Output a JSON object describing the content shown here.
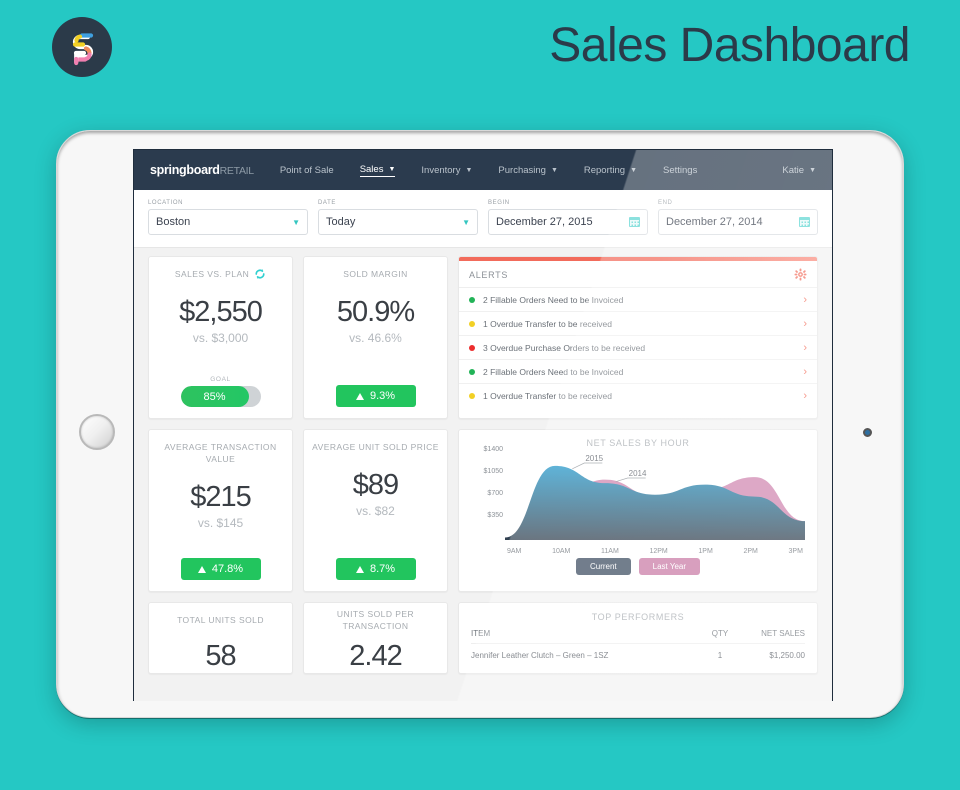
{
  "page": {
    "title": "Sales Dashboard",
    "background_color": "#25C8C4",
    "title_color": "#2B3A49",
    "logo_name": "springboard-logo"
  },
  "navbar": {
    "brand": "springboard",
    "brand_suffix": "RETAIL",
    "items": [
      {
        "label": "Point of Sale",
        "has_caret": false,
        "active": false
      },
      {
        "label": "Sales",
        "has_caret": true,
        "active": true
      },
      {
        "label": "Inventory",
        "has_caret": true,
        "active": false
      },
      {
        "label": "Purchasing",
        "has_caret": true,
        "active": false
      },
      {
        "label": "Reporting",
        "has_caret": true,
        "active": false
      },
      {
        "label": "Settings",
        "has_caret": false,
        "active": false
      }
    ],
    "user": "Katie"
  },
  "filters": [
    {
      "label": "LOCATION",
      "value": "Boston",
      "control": "select"
    },
    {
      "label": "DATE",
      "value": "Today",
      "control": "select"
    },
    {
      "label": "BEGIN",
      "value": "December 27, 2015",
      "control": "date"
    },
    {
      "label": "END",
      "value": "December 27, 2014",
      "control": "date"
    }
  ],
  "kpis": {
    "sales_vs_plan": {
      "title": "SALES VS. PLAN",
      "value": "$2,550",
      "sub": "vs. $3,000",
      "goal_label": "GOAL",
      "goal_value": "85%",
      "goal_percent": 85
    },
    "sold_margin": {
      "title": "SOLD  MARGIN",
      "value": "50.9%",
      "sub": "vs. 46.6%",
      "badge": "9.3%"
    },
    "avg_transaction_value": {
      "title": "AVERAGE TRANSACTION VALUE",
      "value": "$215",
      "sub": "vs. $145",
      "badge": "47.8%"
    },
    "avg_unit_sold_price": {
      "title": "AVERAGE UNIT SOLD PRICE",
      "value": "$89",
      "sub": "vs. $82",
      "badge": "8.7%"
    },
    "total_units_sold": {
      "title": "TOTAL UNITS SOLD",
      "value": "58"
    },
    "units_sold_per_transaction": {
      "title": "UNITS SOLD PER TRANSACTION",
      "value": "2.42"
    }
  },
  "alerts": {
    "title": "ALERTS",
    "accent_color": "#f26b5b",
    "items": [
      {
        "text": "2 Fillable Orders Need to be Invoiced",
        "status_color": "#22b357"
      },
      {
        "text": "1 Overdue Transfer to be received",
        "status_color": "#f2d024"
      },
      {
        "text": "3 Overdue Purchase Orders to be received",
        "status_color": "#ec2d2d"
      },
      {
        "text": "2 Fillable Orders Need to be Invoiced",
        "status_color": "#22b357"
      },
      {
        "text": "1 Overdue Transfer to be received",
        "status_color": "#f2d024"
      }
    ]
  },
  "chart_data": {
    "type": "area",
    "title": "NET SALES BY HOUR",
    "xlabel": "",
    "ylabel": "",
    "ylim": [
      0,
      1400
    ],
    "yticks": [
      "$350",
      "$700",
      "$1050",
      "$1400"
    ],
    "ytick_values": [
      350,
      700,
      1050,
      1400
    ],
    "x": [
      "9AM",
      "10AM",
      "11AM",
      "12PM",
      "1PM",
      "2PM",
      "3PM"
    ],
    "grid": false,
    "legend_position": "bottom",
    "series": [
      {
        "name": "2015",
        "legend": "Current",
        "color": "#3a4a5e",
        "fill_top": "#2196c9",
        "fill_bottom": "#31404f",
        "values": [
          40,
          1180,
          905,
          720,
          880,
          690,
          300
        ]
      },
      {
        "name": "2014",
        "legend": "Last Year",
        "color": "#c878a4",
        "fill": "#cf84ae",
        "values": [
          40,
          640,
          960,
          700,
          800,
          1000,
          300
        ]
      }
    ],
    "annotations": [
      {
        "text": "2015",
        "series": "2015"
      },
      {
        "text": "2014",
        "series": "2014"
      }
    ],
    "legend_buttons": [
      {
        "label": "Current",
        "color": "#3a4a5e"
      },
      {
        "label": "Last Year",
        "color": "#c878a4"
      }
    ]
  },
  "top_performers": {
    "title": "TOP PERFORMERS",
    "columns": [
      "ITEM",
      "QTY",
      "NET SALES"
    ],
    "rows": [
      {
        "item": "Jennifer Leather Clutch – Green – 1SZ",
        "qty": "1",
        "net_sales": "$1,250.00"
      }
    ]
  }
}
